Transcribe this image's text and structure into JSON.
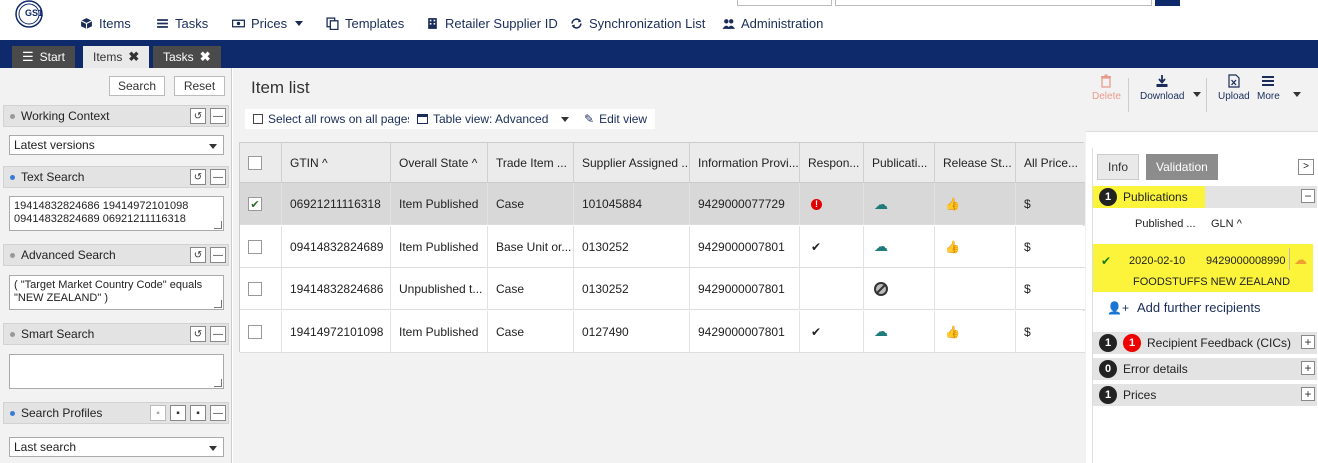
{
  "nav": {
    "items": [
      {
        "label": "Items",
        "icon": "cube-icon"
      },
      {
        "label": "Tasks",
        "icon": "list-icon"
      },
      {
        "label": "Prices",
        "icon": "money-icon"
      },
      {
        "label": "Templates",
        "icon": "copy-icon"
      },
      {
        "label": "Retailer Supplier ID",
        "icon": "building-icon"
      },
      {
        "label": "Synchronization List",
        "icon": "sync-icon"
      },
      {
        "label": "Administration",
        "icon": "users-icon"
      }
    ],
    "logo_text": "GS1"
  },
  "tabs": [
    {
      "label": "Start"
    },
    {
      "label": "Items"
    },
    {
      "label": "Tasks"
    }
  ],
  "left": {
    "search_label": "Search",
    "reset_label": "Reset",
    "working_context": {
      "title": "Working Context",
      "value": "Latest versions"
    },
    "text_search": {
      "title": "Text Search",
      "value": "19414832824686 19414972101098 09414832824689 06921211116318"
    },
    "advanced_search": {
      "title": "Advanced Search",
      "value": "( \"Target Market Country Code\" equals \"NEW ZEALAND\" )"
    },
    "smart_search": {
      "title": "Smart Search",
      "value": ""
    },
    "search_profiles": {
      "title": "Search Profiles",
      "value": "Last search"
    }
  },
  "main": {
    "title": "Item list",
    "select_all_label": "Select all rows on all pages",
    "table_view_label": "Table view: Advanced",
    "edit_view_label": "Edit view",
    "columns": [
      "GTIN",
      "Overall State",
      "Trade Item ...",
      "Supplier Assigned ...",
      "Information Provi...",
      "Respon...",
      "Publicati...",
      "Release St...",
      "All Price..."
    ],
    "rows": [
      {
        "gtin": "06921211116318",
        "state": "Item Published",
        "trade": "Case",
        "supplier": "101045884",
        "provider": "9429000077729",
        "selected": true,
        "response": "error",
        "publication": "cloud",
        "release": "thumb",
        "price": "$"
      },
      {
        "gtin": "09414832824689",
        "state": "Item Published",
        "trade": "Base Unit or...",
        "supplier": "0130252",
        "provider": "9429000007801",
        "selected": false,
        "response": "check",
        "publication": "cloud",
        "release": "thumb",
        "price": "$"
      },
      {
        "gtin": "19414832824686",
        "state": "Unpublished t...",
        "trade": "Case",
        "supplier": "0130252",
        "provider": "9429000007801",
        "selected": false,
        "response": "",
        "publication": "ban",
        "release": "",
        "price": "$"
      },
      {
        "gtin": "19414972101098",
        "state": "Item Published",
        "trade": "Case",
        "supplier": "0127490",
        "provider": "9429000007801",
        "selected": false,
        "response": "check",
        "publication": "cloud",
        "release": "thumb",
        "price": "$"
      }
    ]
  },
  "right": {
    "toolbar": {
      "delete": "Delete",
      "download": "Download",
      "upload": "Upload",
      "more": "More"
    },
    "tabs": {
      "info": "Info",
      "validation": "Validation"
    },
    "publications": {
      "count": "1",
      "title": "Publications",
      "col_published": "Published ...",
      "col_gln": "GLN",
      "date": "2020-02-10",
      "gln": "9429000008990",
      "recipient": "FOODSTUFFS NEW ZEALAND",
      "add_label": "Add further recipients"
    },
    "recipient_feedback": {
      "count": "1",
      "red_count": "1",
      "title": "Recipient Feedback (CICs)"
    },
    "error_details": {
      "count": "0",
      "title": "Error details"
    },
    "prices": {
      "count": "1",
      "title": "Prices"
    }
  },
  "colors": {
    "navy": "#0f2a6b",
    "highlight": "#fbf43a",
    "cloud": "#1f7a7a",
    "error": "#e00000"
  }
}
